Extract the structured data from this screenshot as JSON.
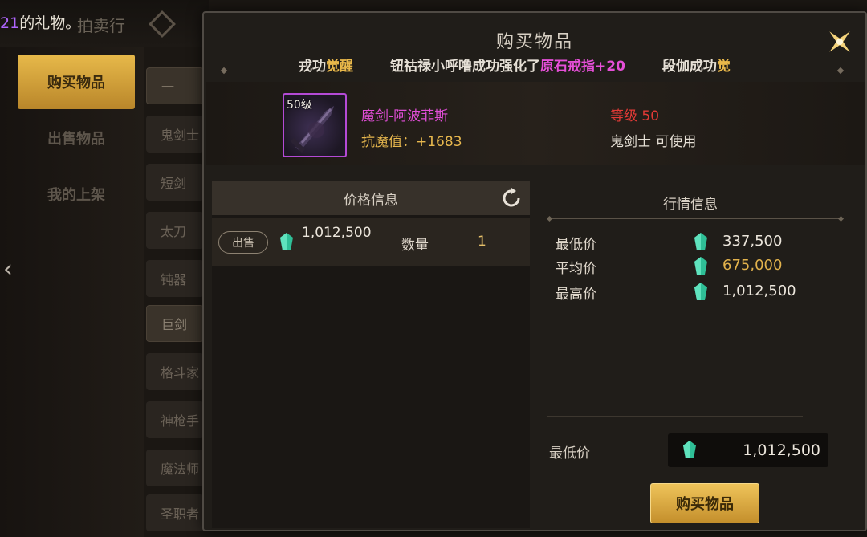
{
  "background": {
    "ticker_number": "21",
    "ticker_text": "的礼物。",
    "auction_label": "拍卖行",
    "sidebar": [
      {
        "label": "购买物品",
        "active": true
      },
      {
        "label": "出售物品",
        "active": false
      },
      {
        "label": "我的上架",
        "active": false
      }
    ],
    "categories": [
      "一",
      "鬼剑士",
      "短剑",
      "太刀",
      "钝器",
      "巨剑",
      "格斗家",
      "神枪手",
      "魔法师",
      "圣职者"
    ]
  },
  "modal": {
    "title": "购买物品",
    "marquee": {
      "seg1_text": "戎功",
      "seg1_highlight": "觉醒",
      "seg2_text": "钮祜禄小呼噜成功强化了",
      "seg2_item": "原石戒指",
      "seg2_level": "+20",
      "seg3_text": "段伽成功",
      "seg3_highlight": "觉"
    },
    "item": {
      "level_badge": "50级",
      "name": "魔剑-阿波菲斯",
      "stat": "抗魔值：+1683",
      "required_level": "等级 50",
      "usable_by": "鬼剑士 可使用"
    },
    "price_info": {
      "header": "价格信息",
      "row": {
        "tag": "出售",
        "price": "1,012,500",
        "qty_label": "数量",
        "qty": "1"
      }
    },
    "market_info": {
      "header": "行情信息",
      "rows": [
        {
          "label": "最低价",
          "value": "337,500"
        },
        {
          "label": "平均价",
          "value": "675,000"
        },
        {
          "label": "最高价",
          "value": "1,012,500"
        }
      ]
    },
    "footer": {
      "min_label": "最低价",
      "min_value": "1,012,500",
      "buy_button": "购买物品"
    }
  },
  "colors": {
    "gold": "#e9b84a",
    "pink": "#e64fd8",
    "red": "#e23a36",
    "gem": "#35c9a4"
  }
}
